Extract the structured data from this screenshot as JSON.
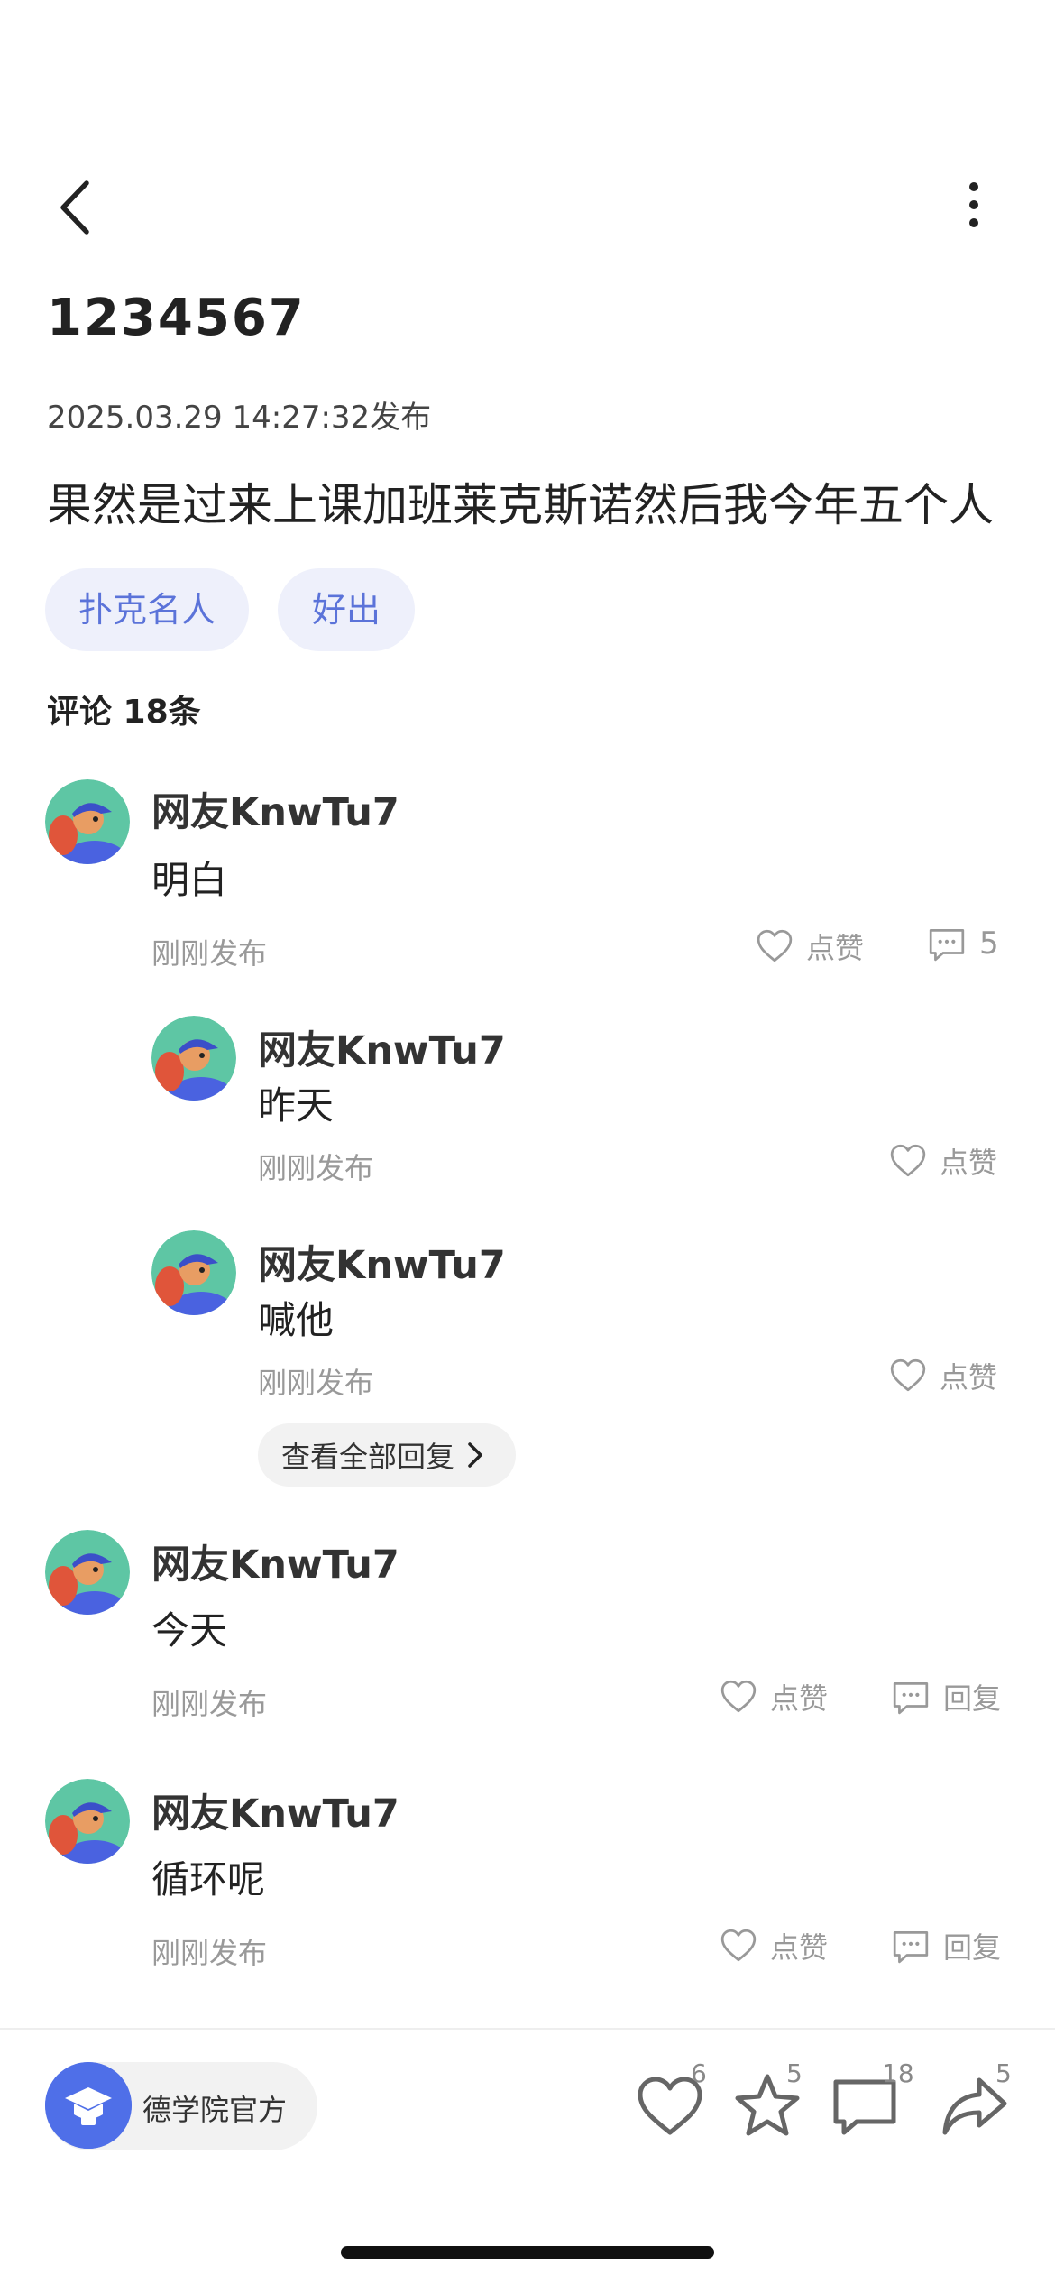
{
  "nav": {
    "back_icon": "chevron-left-icon",
    "more_icon": "vertical-dots-icon"
  },
  "post": {
    "title": "1234567",
    "published": "2025.03.29 14:27:32发布",
    "body": "果然是过来上课加班莱克斯诺然后我今年五个人",
    "tags": [
      "扑克名人",
      "好出"
    ]
  },
  "comments_header": "评论 18条",
  "comments": [
    {
      "user": "网友KnwTu7",
      "text": "明白",
      "time": "刚刚发布",
      "like_label": "点赞",
      "reply_count": "5"
    },
    {
      "user": "网友KnwTu7",
      "text": "今天",
      "time": "刚刚发布",
      "like_label": "点赞",
      "reply_label": "回复"
    },
    {
      "user": "网友KnwTu7",
      "text": "循环呢",
      "time": "刚刚发布",
      "like_label": "点赞",
      "reply_label": "回复"
    }
  ],
  "replies": [
    {
      "user": "网友KnwTu7",
      "text": "昨天",
      "time": "刚刚发布",
      "like_label": "点赞"
    },
    {
      "user": "网友KnwTu7",
      "text": "喊他",
      "time": "刚刚发布",
      "like_label": "点赞"
    }
  ],
  "view_all_replies": "查看全部回复",
  "bottom_bar": {
    "official_name": "德学院官方",
    "like_count": "6",
    "star_count": "5",
    "comment_count": "18",
    "share_count": "5"
  },
  "colors": {
    "tag_bg": "#eef0fb",
    "tag_text": "#5b73d9",
    "accent": "#4f6fe8"
  }
}
